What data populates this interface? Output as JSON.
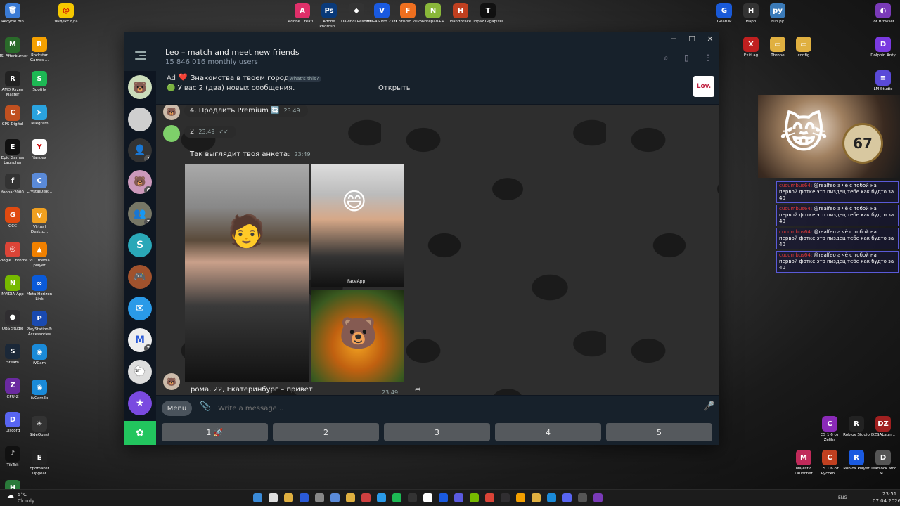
{
  "desktop_left": [
    {
      "label": "Recycle Bin",
      "color": "#3a7bd5",
      "glyph": "🗑"
    },
    {
      "label": "MSI Afterburner",
      "color": "#2a6a2a",
      "glyph": "M"
    },
    {
      "label": "AMD Ryzen Master",
      "color": "#222",
      "glyph": "R"
    },
    {
      "label": "CPS-Digital",
      "color": "#c05020",
      "glyph": "C"
    },
    {
      "label": "Epic Games Launcher",
      "color": "#111",
      "glyph": "E"
    },
    {
      "label": "foobar2000",
      "color": "#333",
      "glyph": "f"
    },
    {
      "label": "GCC",
      "color": "#e04a10",
      "glyph": "G"
    },
    {
      "label": "Google Chrome",
      "color": "#db4437",
      "glyph": "◎"
    },
    {
      "label": "NVIDIA App",
      "color": "#76b900",
      "glyph": "N"
    },
    {
      "label": "OBS Studio",
      "color": "#302e31",
      "glyph": "●"
    },
    {
      "label": "Steam",
      "color": "#1b2838",
      "glyph": "S"
    },
    {
      "label": "CPU-Z",
      "color": "#6a2aa0",
      "glyph": "Z"
    },
    {
      "label": "Discord",
      "color": "#5865f2",
      "glyph": "D"
    },
    {
      "label": "TikTok",
      "color": "#111",
      "glyph": "♪"
    },
    {
      "label": "HidHide Configurat...",
      "color": "#2a7a3a",
      "glyph": "H"
    }
  ],
  "desktop_left2": [
    {
      "label": "Яндекс.Еда",
      "color": "#f5c800",
      "glyph": "@"
    },
    {
      "label": "Rockstar Games ...",
      "color": "#f4a000",
      "glyph": "R"
    },
    {
      "label": "Spotify",
      "color": "#1db954",
      "glyph": "S"
    },
    {
      "label": "Telegram",
      "color": "#2aa3df",
      "glyph": "➤"
    },
    {
      "label": "Yandex",
      "color": "#fff",
      "glyph": "Y"
    },
    {
      "label": "CrystalDisk...",
      "color": "#5a8ad8",
      "glyph": "C"
    },
    {
      "label": "Virtual Deskto...",
      "color": "#f0a020",
      "glyph": "V"
    },
    {
      "label": "VLC media player",
      "color": "#f08000",
      "glyph": "▲"
    },
    {
      "label": "Meta Horizon Link",
      "color": "#0a5ad8",
      "glyph": "∞"
    },
    {
      "label": "PlayStation® Accessories",
      "color": "#1a4ab0",
      "glyph": "P"
    },
    {
      "label": "iVCam",
      "color": "#1a8ad8",
      "glyph": "◉"
    },
    {
      "label": "iVCamEx",
      "color": "#1a8ad8",
      "glyph": "◉"
    },
    {
      "label": "SideQuest",
      "color": "#333",
      "glyph": "✳"
    },
    {
      "label": "Epomaker Upgear",
      "color": "#222",
      "glyph": "E"
    }
  ],
  "desktop_top": [
    {
      "label": "Adobe Creati...",
      "color": "#e0306a",
      "glyph": "A"
    },
    {
      "label": "Adobe Photosh...",
      "color": "#0a3a7a",
      "glyph": "Ps"
    },
    {
      "label": "DaVinci Resolve",
      "color": "#333",
      "glyph": "◆"
    },
    {
      "label": "VEGAS Pro 23.0",
      "color": "#1a5ae0",
      "glyph": "V"
    },
    {
      "label": "FL Studio 2025",
      "color": "#f07020",
      "glyph": "F"
    },
    {
      "label": "Notepad++",
      "color": "#8ab83a",
      "glyph": "N"
    },
    {
      "label": "HandBrake",
      "color": "#c04020",
      "glyph": "H"
    },
    {
      "label": "Topaz Gigapixel",
      "color": "#111",
      "glyph": "T"
    }
  ],
  "desktop_right_top": [
    {
      "label": "GearUP",
      "color": "#1a5ad8",
      "glyph": "G"
    },
    {
      "label": "Happ",
      "color": "#333",
      "glyph": "H"
    },
    {
      "label": "run.py",
      "color": "#3a7ab8",
      "glyph": "py"
    },
    {
      "label": "Tor Browser",
      "color": "#7a3ab8",
      "glyph": "◐"
    },
    {
      "label": "ExitLag",
      "color": "#c02020",
      "glyph": "X"
    },
    {
      "label": "Throne",
      "color": "#e0b040",
      "glyph": "▭"
    },
    {
      "label": "config",
      "color": "#e0b040",
      "glyph": "▭"
    },
    {
      "label": "Dolphin Anty",
      "color": "#7a3ae0",
      "glyph": "D"
    },
    {
      "label": "LM Studio",
      "color": "#5a4ad8",
      "glyph": "≡"
    }
  ],
  "desktop_right_bottom": [
    {
      "label": "CS 1.6 от Zelihs",
      "color": "#8a2ab8",
      "glyph": "C"
    },
    {
      "label": "Roblox Studio",
      "color": "#222",
      "glyph": "R"
    },
    {
      "label": "DZSALaun...",
      "color": "#a02020",
      "glyph": "DZ"
    },
    {
      "label": "Majestic Launcher",
      "color": "#c02a5a",
      "glyph": "M"
    },
    {
      "label": "CS 1.6 от Русско...",
      "color": "#c04020",
      "glyph": "C"
    },
    {
      "label": "Roblox Player",
      "color": "#1a5ae0",
      "glyph": "R"
    },
    {
      "label": "Deadlock Mod M...",
      "color": "#555",
      "glyph": "D"
    }
  ],
  "twitch_chat": [
    {
      "user": "cucumbus64:",
      "text": "@realfeo а чё с тобой на первой фотке это пиздец тебе как будто за 40"
    },
    {
      "user": "cucumbus64:",
      "text": "@realfeo а чё с тобой на первой фотке это пиздец тебе как будто за 40"
    },
    {
      "user": "cucumbus64:",
      "text": "@realfeo а чё с тобой на первой фотке это пиздец тебе как будто за 40"
    },
    {
      "user": "cucumbus64:",
      "text": "@realfeo а чё с тобой на первой фотке это пиздец тебе как будто за 40"
    }
  ],
  "telegram": {
    "title": "Leo – match and meet new friends",
    "subtitle": "15 846 016 monthly users",
    "ad": {
      "label": "Ad",
      "heart": "❤️",
      "title": "Знакомства в твоем городе",
      "whats_this": "what's this?",
      "text": "🟢 У вас 2 (два) новых сообщения.",
      "open": "Открыть",
      "logo": "Lov."
    },
    "messages": {
      "m1": "4. Продлить Premium 🔄",
      "m1_time": "23:49",
      "m2": "2",
      "m2_time": "23:49",
      "m3": "Так выглядит твоя анкета:",
      "m3_time": "23:49",
      "photo_tag": "FaceApp",
      "caption": "рома, 22, Екатеринбург – привет",
      "caption_time": "23:49"
    },
    "composer": {
      "menu": "Menu",
      "placeholder": "Write a message..."
    },
    "keyboard": [
      "1 🚀",
      "2",
      "3",
      "4",
      "5"
    ],
    "badges": [
      "1",
      "6",
      "3",
      "2"
    ]
  },
  "taskbar": {
    "weather_temp": "5°C",
    "weather_text": "Cloudy",
    "lang": "ENG",
    "time": "23:51",
    "date": "07.04.2026"
  },
  "colors": {
    "telegram_bg": "#17212b",
    "accent": "#2aa3df"
  }
}
